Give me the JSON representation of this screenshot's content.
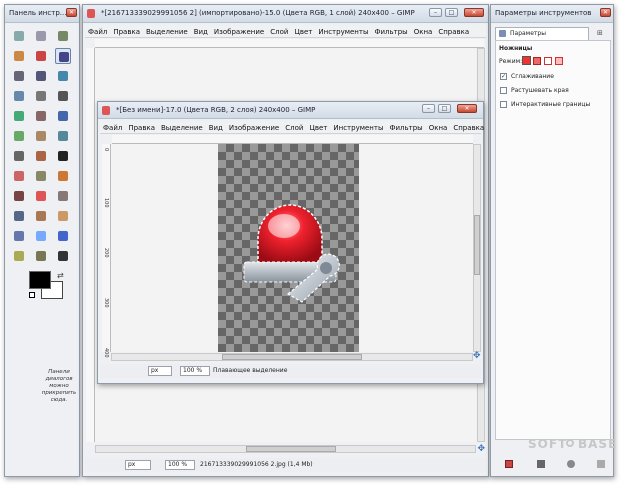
{
  "toolbox": {
    "title": "Панель инстр...",
    "hint_text": "Панели диалогов можно прикрепить сюда."
  },
  "main_window": {
    "title": "*[216713339029991056 2] (импортировано)-15.0 (Цвета RGB, 1 слой) 240x400 – GIMP",
    "menu": [
      "Файл",
      "Правка",
      "Выделение",
      "Вид",
      "Изображение",
      "Слой",
      "Цвет",
      "Инструменты",
      "Фильтры",
      "Окна",
      "Справка"
    ],
    "status": {
      "unit": "px",
      "zoom": "100 %",
      "file_info": "216713339029991056 2.jpg (1,4 Mb)"
    }
  },
  "inner_window": {
    "title": "*[Без имени]-17.0 (Цвета RGB, 2 слоя) 240x400 – GIMP",
    "menu": [
      "Файл",
      "Правка",
      "Выделение",
      "Вид",
      "Изображение",
      "Слой",
      "Цвет",
      "Инструменты",
      "Фильтры",
      "Окна",
      "Справка"
    ],
    "ruler_marks": [
      "0",
      "100",
      "200",
      "300",
      "400"
    ],
    "status": {
      "unit": "px",
      "zoom": "100 %",
      "message": "Плавающее выделение"
    }
  },
  "tool_options": {
    "title": "Параметры инструментов",
    "tab_label": "Параметры инструмента",
    "tool_name": "Ножницы",
    "mode_label": "Режим:",
    "options": [
      {
        "label": "Сглаживание",
        "checked": true
      },
      {
        "label": "Растушевать края",
        "checked": false
      },
      {
        "label": "Интерактивные границы",
        "checked": false
      }
    ]
  },
  "watermark": {
    "line1": "SOFT",
    "line2": "BASE"
  },
  "colors": {
    "accent_red": "#e0202a",
    "checker_dark": "#666666",
    "checker_light": "#999999"
  }
}
